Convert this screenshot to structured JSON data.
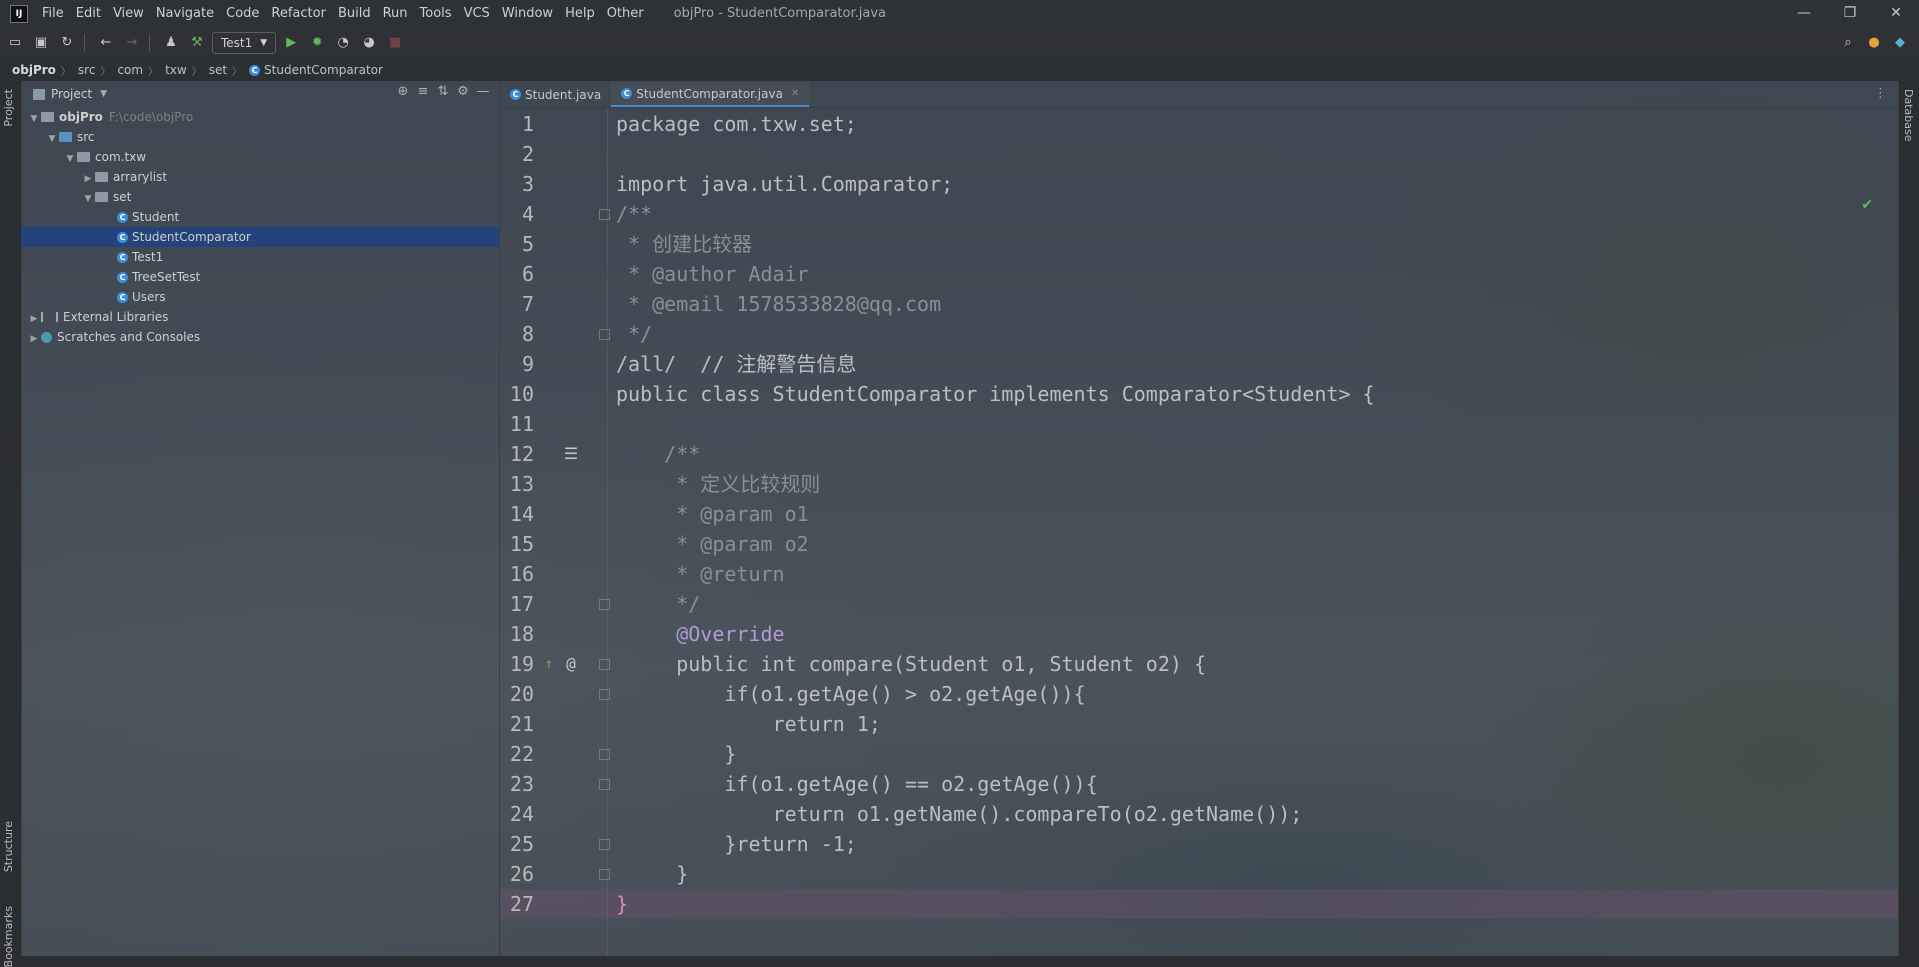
{
  "window": {
    "app_icon": "IJ",
    "title": "objPro - StudentComparator.java",
    "controls": [
      "—",
      "❐",
      "✕"
    ]
  },
  "menu": [
    "File",
    "Edit",
    "View",
    "Navigate",
    "Code",
    "Refactor",
    "Build",
    "Run",
    "Tools",
    "VCS",
    "Window",
    "Help",
    "Other"
  ],
  "toolbar": {
    "run_config": "Test1"
  },
  "breadcrumb": [
    "objPro",
    "src",
    "com",
    "txw",
    "set",
    "StudentComparator"
  ],
  "left_stripe": {
    "top_label": "Project",
    "structure_label": "Structure",
    "bookmarks_label": "Bookmarks"
  },
  "right_stripe": {
    "label": "Database"
  },
  "project_panel": {
    "title": "Project",
    "tree": [
      {
        "label": "objPro",
        "hint": "F:\\code\\objPro",
        "kind": "folder",
        "expanded": true
      },
      {
        "label": "src",
        "kind": "src",
        "expanded": true
      },
      {
        "label": "com.txw",
        "kind": "folder",
        "expanded": true
      },
      {
        "label": "arrarylist",
        "kind": "folder",
        "expanded": false
      },
      {
        "label": "set",
        "kind": "folder",
        "expanded": true
      },
      {
        "label": "Student",
        "kind": "class"
      },
      {
        "label": "StudentComparator",
        "kind": "class",
        "selected": true
      },
      {
        "label": "Test1",
        "kind": "class"
      },
      {
        "label": "TreeSetTest",
        "kind": "class"
      },
      {
        "label": "Users",
        "kind": "class"
      },
      {
        "label": "External Libraries",
        "kind": "libs",
        "expanded": false
      },
      {
        "label": "Scratches and Consoles",
        "kind": "scratch",
        "expanded": false
      }
    ]
  },
  "editor": {
    "tabs": [
      {
        "label": "Student.java",
        "active": false
      },
      {
        "label": "StudentComparator.java",
        "active": true
      }
    ],
    "line_numbers": [
      "1",
      "2",
      "3",
      "4",
      "5",
      "6",
      "7",
      "8",
      "9",
      "10",
      "11",
      "12",
      "13",
      "14",
      "15",
      "16",
      "17",
      "18",
      "19",
      "20",
      "21",
      "22",
      "23",
      "24",
      "25",
      "26",
      "27"
    ],
    "lines": [
      "package com.txw.set;",
      "",
      "import java.util.Comparator;",
      "/**",
      " * 创建比较器",
      " * @author Adair",
      " * @email 1578533828@qq.com",
      " */",
      "/all/  // 注解警告信息",
      "public class StudentComparator implements Comparator<Student> {",
      "",
      "    /**",
      "     * 定义比较规则",
      "     * @param o1",
      "     * @param o2",
      "     * @return",
      "     */",
      "     @Override",
      "     public int compare(Student o1, Student o2) {",
      "         if(o1.getAge() > o2.getAge()){",
      "             return 1;",
      "         }",
      "         if(o1.getAge() == o2.getAge()){",
      "             return o1.getName().compareTo(o2.getName());",
      "         }return -1;",
      "     }",
      "}"
    ],
    "caret_line": 27
  },
  "colors": {
    "keyword": "#e8779a",
    "package": "#78b4d8",
    "class": "#6fa8dc",
    "comment": "#8a8f96",
    "annotation": "#b399d4",
    "number": "#2aacb8",
    "selection": "#214283"
  }
}
